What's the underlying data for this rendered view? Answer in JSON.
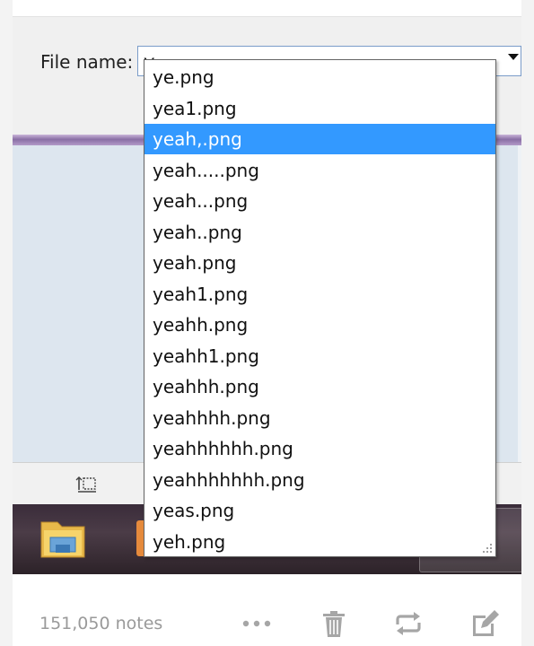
{
  "dialog": {
    "filename_label": "File name:",
    "filename_value": "y"
  },
  "autocomplete": {
    "items": [
      {
        "label": "ye.png",
        "selected": false
      },
      {
        "label": "yea1.png",
        "selected": false
      },
      {
        "label": "yeah,.png",
        "selected": true
      },
      {
        "label": "yeah.....png",
        "selected": false
      },
      {
        "label": "yeah...png",
        "selected": false
      },
      {
        "label": "yeah..png",
        "selected": false
      },
      {
        "label": "yeah.png",
        "selected": false
      },
      {
        "label": "yeah1.png",
        "selected": false
      },
      {
        "label": "yeahh.png",
        "selected": false
      },
      {
        "label": "yeahh1.png",
        "selected": false
      },
      {
        "label": "yeahhh.png",
        "selected": false
      },
      {
        "label": "yeahhhh.png",
        "selected": false
      },
      {
        "label": "yeahhhhhh.png",
        "selected": false
      },
      {
        "label": "yeahhhhhhh.png",
        "selected": false
      },
      {
        "label": "yeas.png",
        "selected": false
      },
      {
        "label": "yeh.png",
        "selected": false
      }
    ]
  },
  "footer": {
    "notes": "151,050 notes",
    "icons": [
      "more-icon",
      "trash-icon",
      "reblog-icon",
      "edit-icon"
    ]
  },
  "colors": {
    "selection": "#3399ff",
    "input_border": "#7a9cc9",
    "footer_icon": "#a6a6a6"
  }
}
